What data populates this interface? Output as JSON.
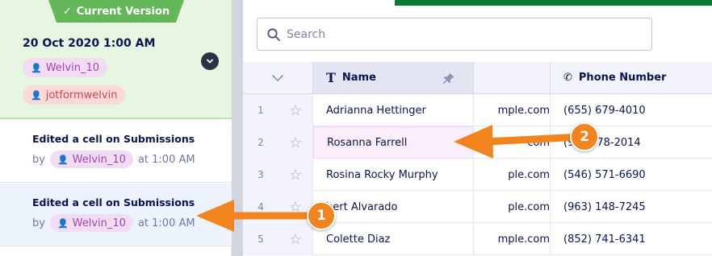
{
  "history": {
    "current": {
      "ribbon_label": "Current Version",
      "date": "20 Oct 2020 1:00 AM",
      "users": [
        "Welvin_10",
        "jotformwelvin"
      ]
    },
    "entries": [
      {
        "title": "Edited a cell on Submissions",
        "by": "by",
        "user": "Welvin_10",
        "time": "at 1:00 AM"
      },
      {
        "title": "Edited a cell on Submissions",
        "by": "by",
        "user": "Welvin_10",
        "time": "at 1:00 AM"
      }
    ]
  },
  "search": {
    "placeholder": "Search"
  },
  "table": {
    "columns": {
      "name": "Name",
      "phone": "Phone Number"
    },
    "rows": [
      {
        "num": "1",
        "name": "Adrianna Hettinger",
        "email_fragment": "mple.com",
        "phone": "(655) 679-4010"
      },
      {
        "num": "2",
        "name": "Rosanna Farrell",
        "email_fragment": "com",
        "phone": "(9",
        "phone_tail": "78-2014"
      },
      {
        "num": "3",
        "name": "Rosina Rocky Murphy",
        "email_fragment": "ple.com",
        "phone": "(546) 571-6690"
      },
      {
        "num": "4",
        "name": "bert Alvarado",
        "email_fragment": "ple.com",
        "phone": "(963) 148-7245"
      },
      {
        "num": "5",
        "name": "Colette Diaz",
        "email_fragment": "mple.com",
        "phone": "(852) 741-6341"
      }
    ]
  },
  "annotations": {
    "badge_1": "1",
    "badge_2": "2"
  },
  "colors": {
    "accent_green": "#64b759",
    "arrow_orange": "#f2841f",
    "user_chip": "#f2dcf4"
  }
}
